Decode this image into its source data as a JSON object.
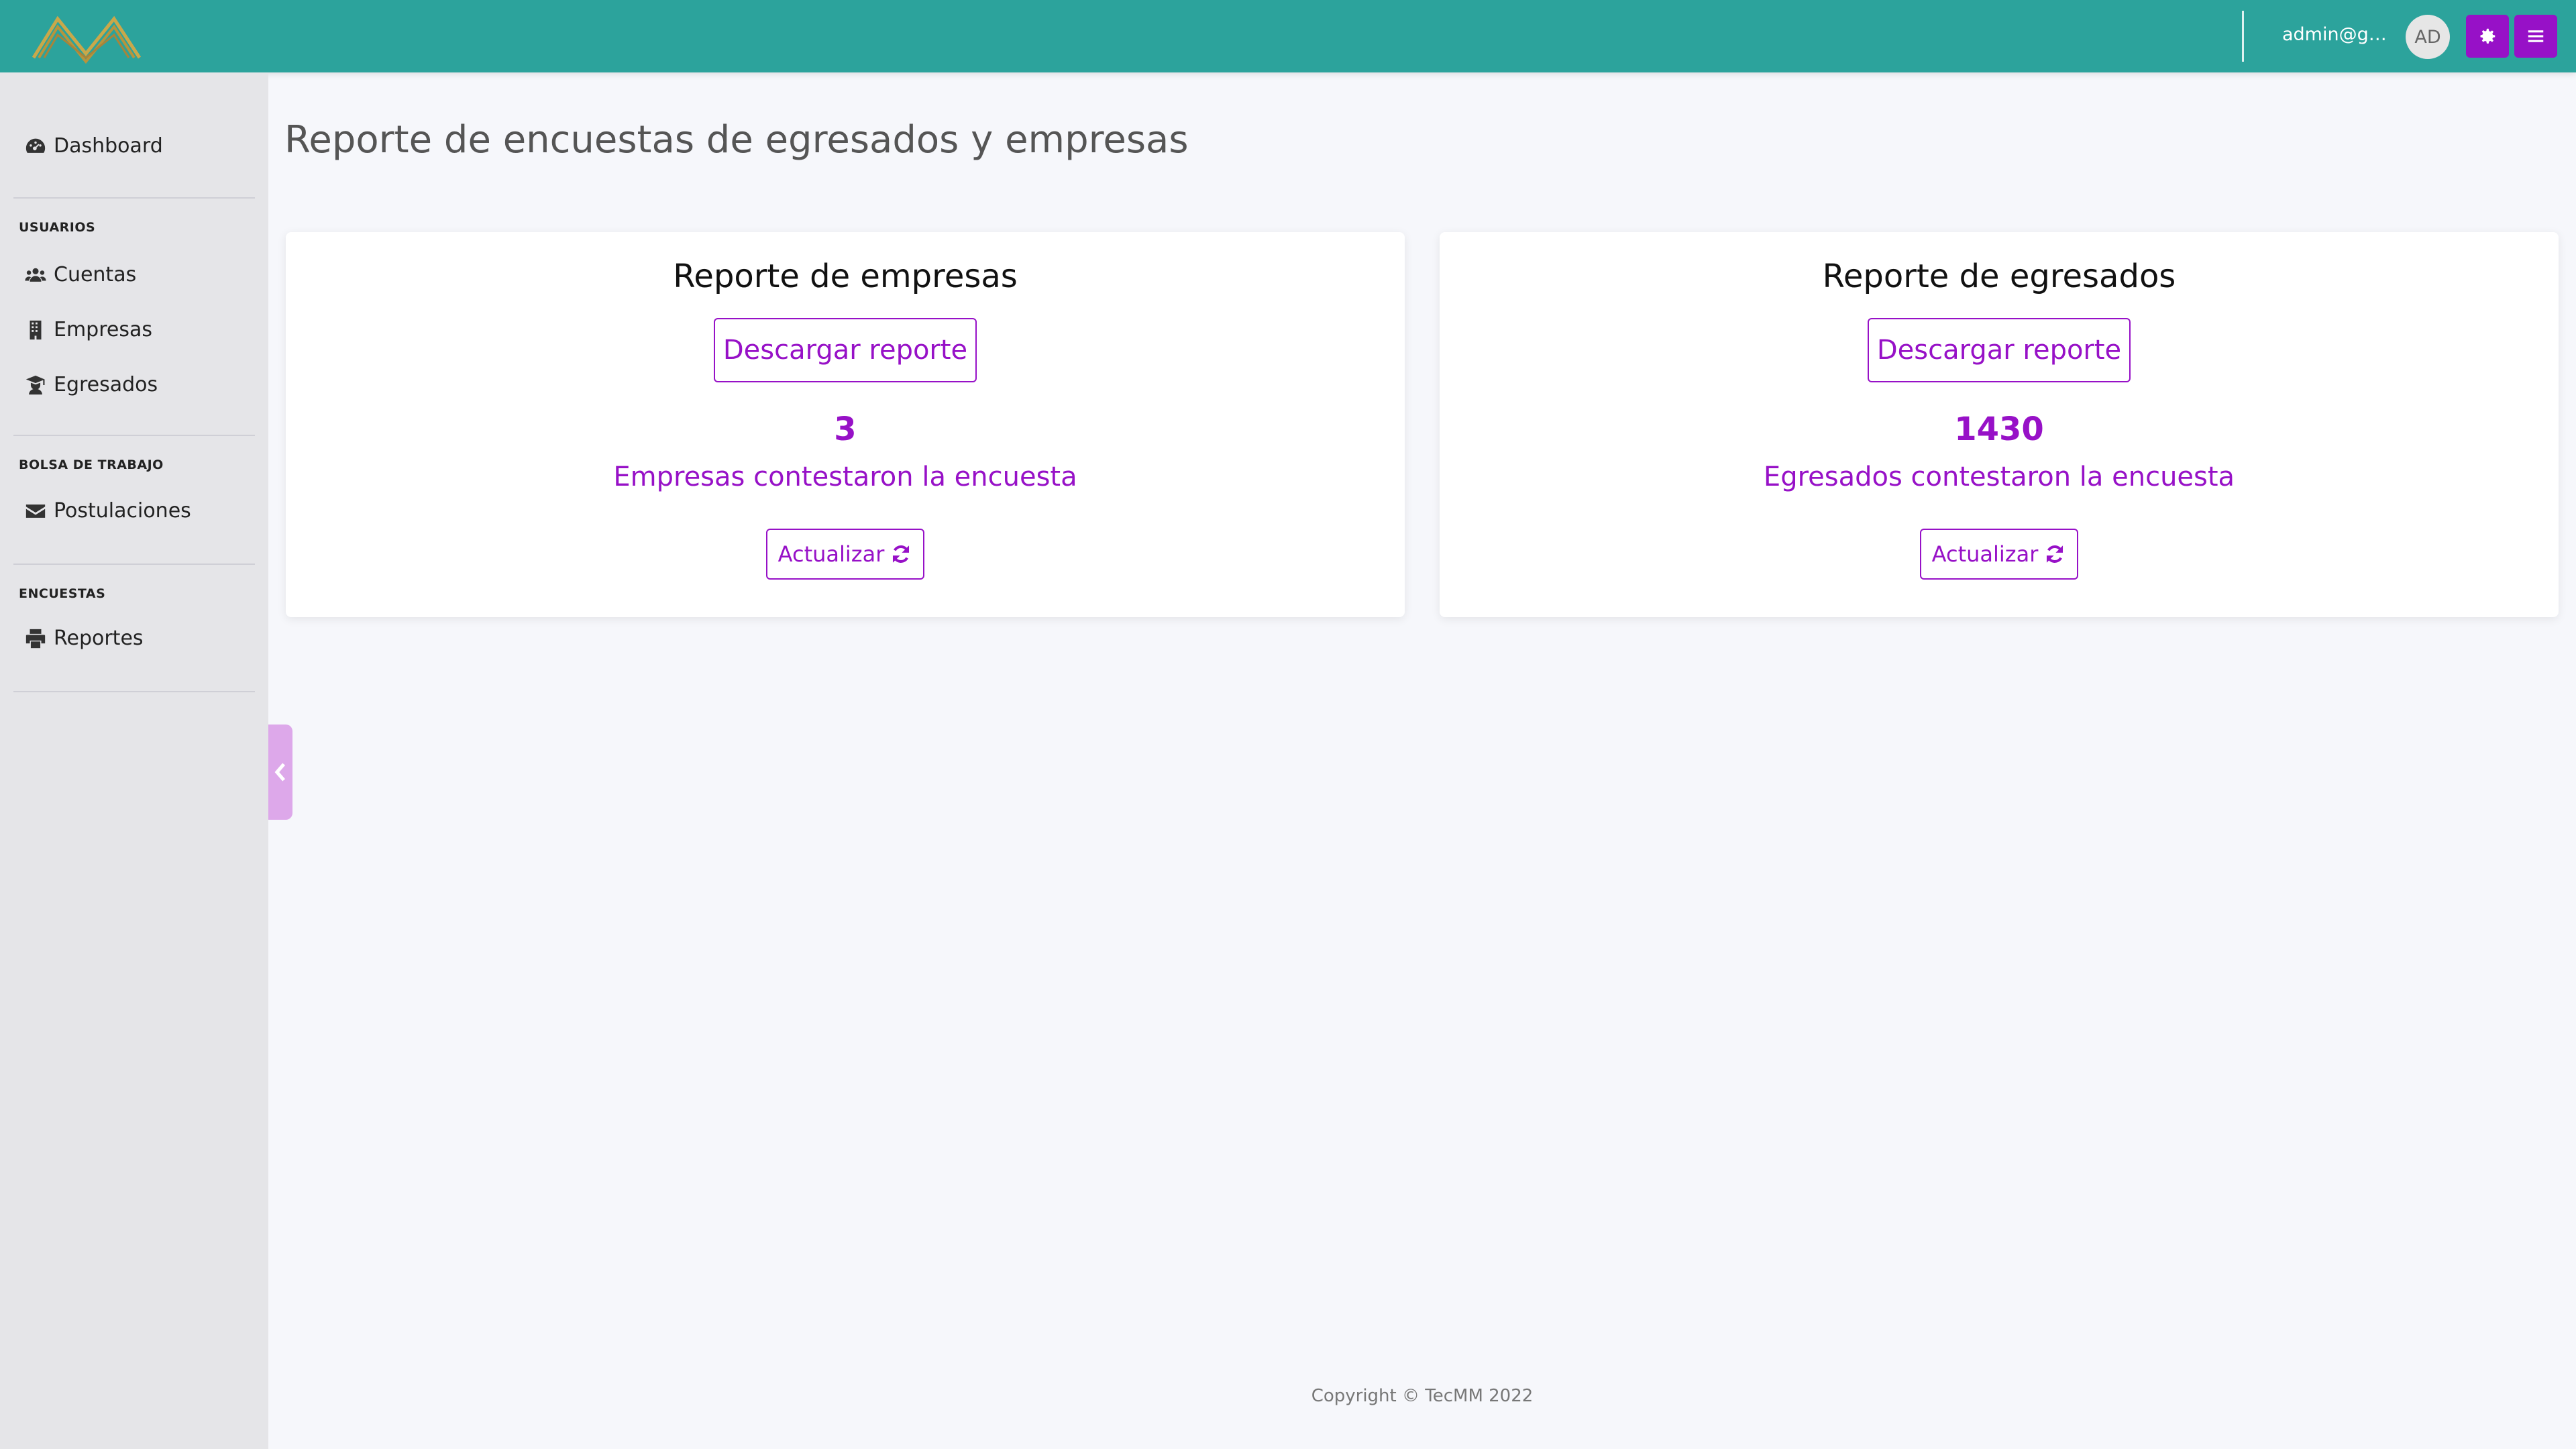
{
  "header": {
    "user_email": "admin@gmai...",
    "avatar_initials": "AD",
    "accent_color": "#2ca39c",
    "button_color": "#9711c7"
  },
  "sidebar": {
    "dashboard": "Dashboard",
    "sections": [
      {
        "title": "USUARIOS",
        "items": [
          "Cuentas",
          "Empresas",
          "Egresados"
        ]
      },
      {
        "title": "BOLSA DE TRABAJO",
        "items": [
          "Postulaciones"
        ]
      },
      {
        "title": "ENCUESTAS",
        "items": [
          "Reportes"
        ]
      }
    ],
    "icons": [
      "dashboard-icon",
      "users-icon",
      "building-icon",
      "graduate-icon",
      "envelope-icon",
      "printer-icon"
    ]
  },
  "main": {
    "title": "Reporte de encuestas de egresados y empresas",
    "cards": [
      {
        "title": "Reporte de empresas",
        "download_label": "Descargar reporte",
        "count": "3",
        "count_label": "Empresas contestaron la encuesta",
        "refresh_label": "Actualizar"
      },
      {
        "title": "Reporte de egresados",
        "download_label": "Descargar reporte",
        "count": "1430",
        "count_label": "Egresados contestaron la encuesta",
        "refresh_label": "Actualizar"
      }
    ]
  },
  "footer": {
    "copyright": "Copyright © TecMM 2022"
  }
}
